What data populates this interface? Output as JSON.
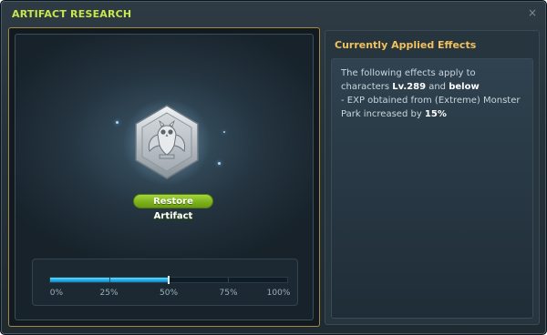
{
  "window": {
    "title": "ARTIFACT RESEARCH",
    "close_glyph": "×"
  },
  "artifact": {
    "icon": "owl-emblem-icon",
    "restore_label": "Restore Artifact"
  },
  "progress": {
    "value_percent": 50,
    "labels": [
      "0%",
      "25%",
      "50%",
      "75%",
      "100%"
    ]
  },
  "effects": {
    "heading": "Currently Applied Effects",
    "intro": {
      "prefix": "The following effects apply to characters ",
      "level": "Lv.289",
      "middle": " and ",
      "qualifier": "below"
    },
    "items": [
      {
        "prefix": "- EXP obtained from (Extreme) Monster Park increased by ",
        "value": "15%"
      }
    ]
  },
  "colors": {
    "title": "#c8e84a",
    "heading": "#f3c15a",
    "button": "#8cc22a",
    "progress_fill": "#1ea9e6"
  }
}
